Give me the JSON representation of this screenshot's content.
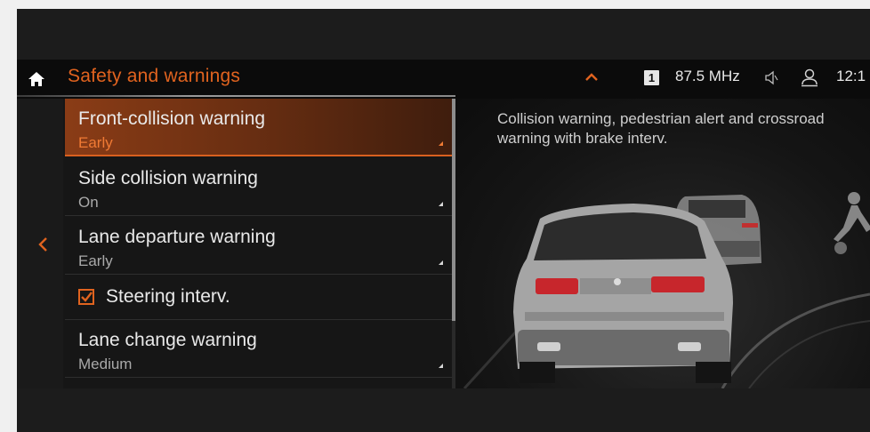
{
  "header": {
    "title": "Safety and warnings",
    "preset_number": "1",
    "radio_frequency": "87.5 MHz",
    "clock": "12:1",
    "icons": [
      "home-icon",
      "chevron-up-icon",
      "speaker-icon",
      "profile-icon"
    ]
  },
  "menu": {
    "items": [
      {
        "label": "Front-collision warning",
        "value": "Early",
        "selected": true
      },
      {
        "label": "Side collision warning",
        "value": "On",
        "selected": false
      },
      {
        "label": "Lane departure warning",
        "value": "Early",
        "selected": false
      },
      {
        "label": "Steering interv.",
        "checked": true
      },
      {
        "label": "Lane change warning",
        "value": "Medium",
        "selected": false
      }
    ]
  },
  "info": {
    "description": "Collision warning, pedestrian alert and crossroad warning with brake interv."
  },
  "colors": {
    "accent": "#e0631f",
    "selected_bg": "#7a3514",
    "background": "#1c1c1c",
    "topbar": "#0b0b0b"
  }
}
